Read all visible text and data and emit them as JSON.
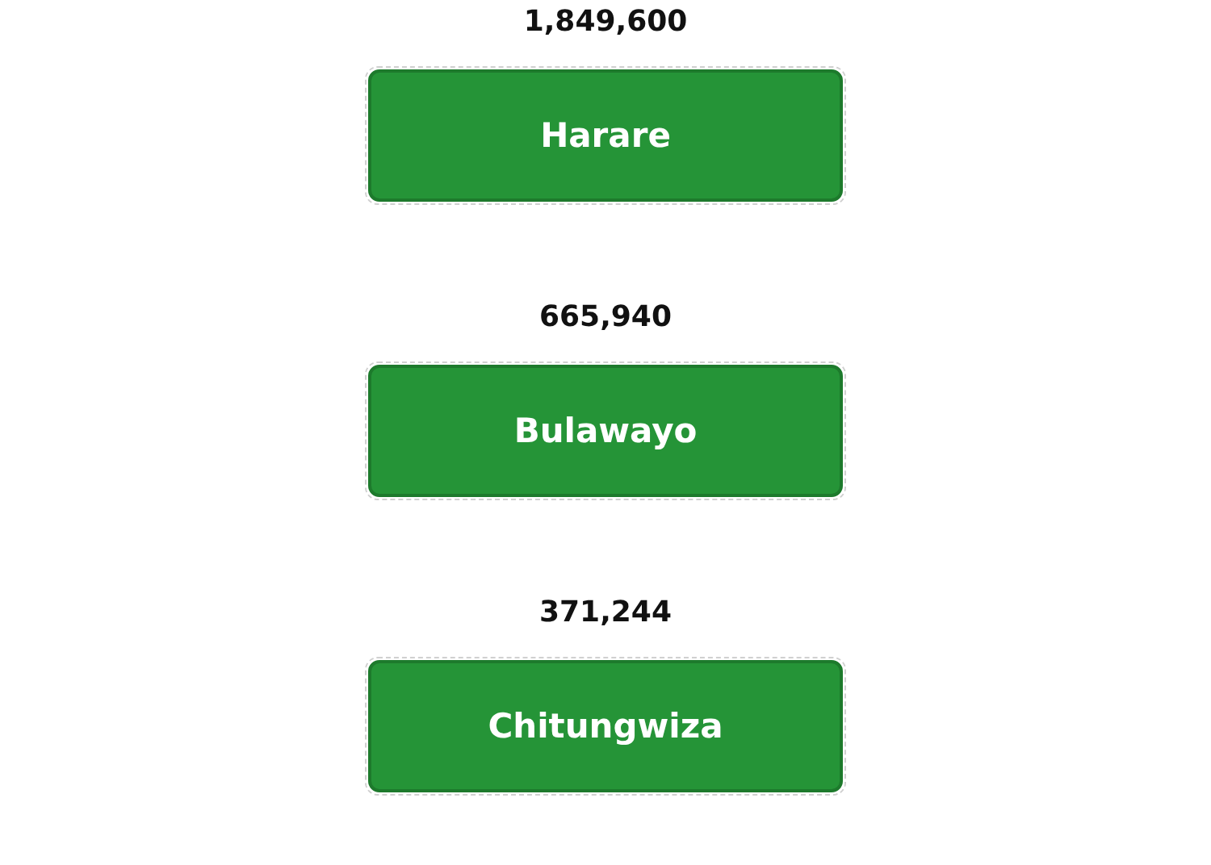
{
  "cities": [
    {
      "population": "1,849,600",
      "name": "Harare"
    },
    {
      "population": "665,940",
      "name": "Bulawayo"
    },
    {
      "population": "371,244",
      "name": "Chitungwiza"
    }
  ]
}
